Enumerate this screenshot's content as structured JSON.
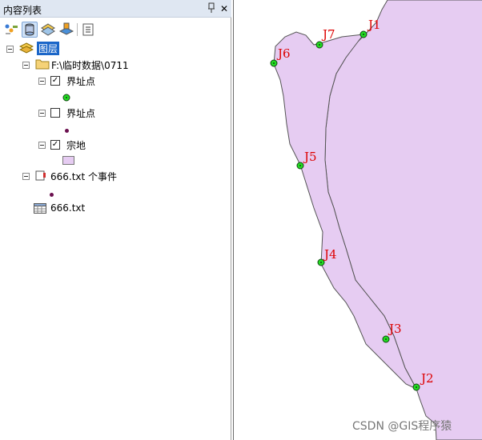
{
  "toc": {
    "title": "内容列表",
    "pin_glyph": "ᵽ",
    "close_glyph": "✕",
    "toolbar": {
      "icons": [
        "list-by-drawing-order-icon",
        "list-by-source-icon",
        "list-by-visibility-icon",
        "list-by-selection-icon",
        "options-icon"
      ]
    },
    "root_label": "图层",
    "folder_label": "F:\\临时数据\\0711",
    "layers": [
      {
        "label": "界址点",
        "checked": true,
        "symbol": "green-point"
      },
      {
        "label": "界址点",
        "checked": false,
        "symbol": "dark-point"
      },
      {
        "label": "宗地",
        "checked": true,
        "symbol": "purple-polygon"
      }
    ],
    "events_label": "666.txt 个事件",
    "table_label": "666.txt"
  },
  "map": {
    "fill_color": "#e6ccf2",
    "outline_color": "#555555",
    "point_color": "#22dd22",
    "label_color": "#dd0000",
    "points": [
      "J1",
      "J2",
      "J3",
      "J4",
      "J5",
      "J6",
      "J7"
    ]
  },
  "watermark": "CSDN @GIS程序猿"
}
